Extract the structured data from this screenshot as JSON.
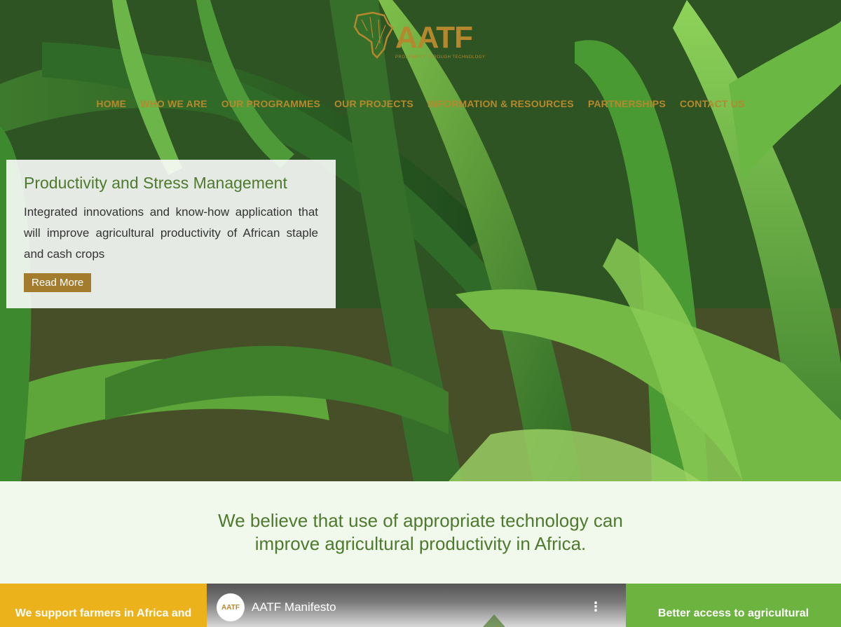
{
  "brand": {
    "logo_text": "AATF",
    "tagline": "PROSPERITY THROUGH TECHNOLOGY",
    "gold": "#b5882e",
    "green": "#4e7a2e"
  },
  "nav": {
    "items": [
      {
        "label": "HOME"
      },
      {
        "label": "WHO WE ARE"
      },
      {
        "label": "OUR PROGRAMMES"
      },
      {
        "label": "OUR PROJECTS"
      },
      {
        "label": "INFORMATION & RESOURCES"
      },
      {
        "label": "PARTNERSHIPS"
      },
      {
        "label": "CONTACT US"
      }
    ]
  },
  "hero": {
    "title": "Productivity and Stress Management",
    "body": "Integrated innovations and know-how application that will improve agricultural productivity of African staple and cash crops",
    "cta_label": "Read More"
  },
  "belief": {
    "line1": "We believe that use of appropriate technology can",
    "line2": "improve agricultural productivity in Africa."
  },
  "features": {
    "left_text": "We support farmers in Africa and",
    "video_channel": "AATF",
    "video_title": "AATF Manifesto",
    "video_menu_icon": "more-vertical-icon",
    "right_text": "Better access to agricultural",
    "left_color": "#ecb21c",
    "right_color": "#6cb33f"
  }
}
